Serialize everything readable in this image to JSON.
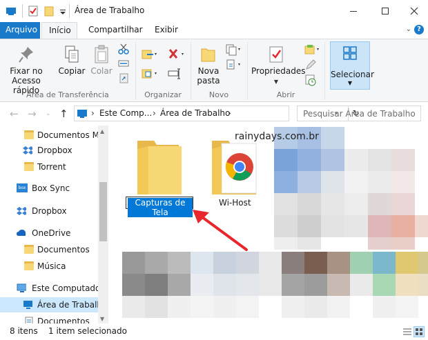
{
  "window": {
    "title": "Área de Trabalho",
    "controls": [
      "minimize-icon",
      "maximize-icon",
      "close-icon"
    ]
  },
  "ribbon_tabs": {
    "file": "Arquivo",
    "home": "Início",
    "share": "Compartilhar",
    "view": "Exibir",
    "help": "?"
  },
  "ribbon": {
    "pin_line1": "Fixar no",
    "pin_line2": "Acesso rápido",
    "copy": "Copiar",
    "paste": "Colar",
    "clipboard_group": "Área de Transferência",
    "organize_group": "Organizar",
    "new_folder_line1": "Nova",
    "new_folder_line2": "pasta",
    "new_group": "Novo",
    "properties": "Propriedades",
    "open_group": "Abrir",
    "select": "Selecionar"
  },
  "address_bar": {
    "crumb1": "Este Comp...",
    "crumb2": "Área de Trabalho",
    "search_placeholder": "Pesquisar Área de Trabalho"
  },
  "sidebar": {
    "items": [
      {
        "label": "Documentos Má",
        "icon": "folder-icon"
      },
      {
        "label": "Dropbox",
        "icon": "dropbox-icon"
      },
      {
        "label": "Torrent",
        "icon": "folder-icon"
      },
      {
        "label": "Box Sync",
        "icon": "box-icon"
      },
      {
        "label": "Dropbox",
        "icon": "dropbox-icon"
      },
      {
        "label": "OneDrive",
        "icon": "onedrive-icon"
      },
      {
        "label": "Documentos",
        "icon": "folder-icon"
      },
      {
        "label": "Música",
        "icon": "folder-icon"
      },
      {
        "label": "Este Computador",
        "icon": "computer-icon"
      },
      {
        "label": "Área de Trabalho",
        "icon": "desktop-icon"
      },
      {
        "label": "Documentos",
        "icon": "documents-icon"
      }
    ]
  },
  "content": {
    "watermark": "rainydays.com.br",
    "items": [
      {
        "name": "Capturas de Tela",
        "renaming": true
      },
      {
        "name": "Wi-Host",
        "renaming": false
      }
    ]
  },
  "status_bar": {
    "item_count": "8 itens",
    "selection": "1 item selecionado"
  },
  "colors": {
    "accent": "#1979ca",
    "selection": "#cce8ff",
    "folder": "#f8d775",
    "arrow": "#e8262c"
  }
}
